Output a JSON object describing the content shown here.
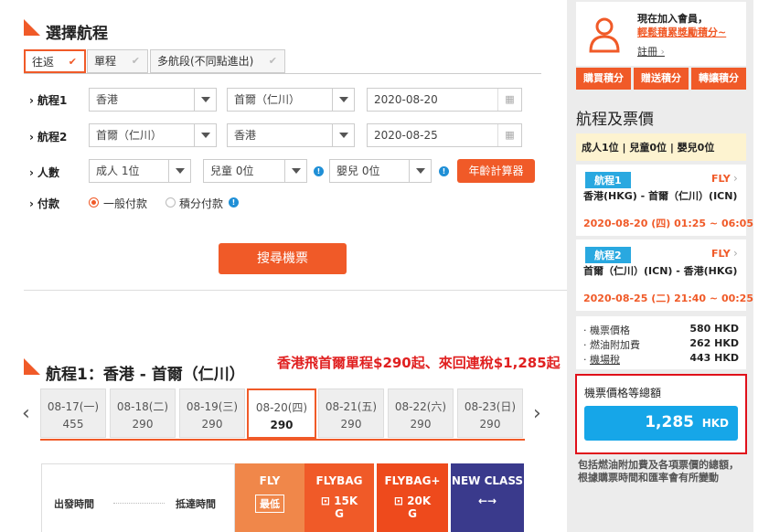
{
  "search": {
    "title": "選擇航程",
    "tabs": [
      {
        "label": "往返",
        "active": true
      },
      {
        "label": "單程",
        "active": false
      },
      {
        "label": "多航段(不同點進出)",
        "active": false
      }
    ],
    "leg1": {
      "label": "航程1",
      "from": "香港",
      "to": "首爾（仁川）",
      "date": "2020-08-20"
    },
    "leg2": {
      "label": "航程2",
      "from": "首爾（仁川）",
      "to": "香港",
      "date": "2020-08-25"
    },
    "pax": {
      "label": "人數",
      "adult": "成人 1位",
      "child": "兒童 0位",
      "infant": "嬰兒 0位",
      "age_calc": "年齡計算器"
    },
    "payment": {
      "label": "付款",
      "opt1": "一般付款",
      "opt2": "積分付款"
    },
    "search_button": "搜尋機票"
  },
  "results": {
    "title": "航程1：香港 - 首爾（仁川）",
    "promo": "香港飛首爾單程$290起、來回連稅$1,285起",
    "dates": [
      {
        "date": "08-17(一)",
        "price": "455",
        "active": false
      },
      {
        "date": "08-18(二)",
        "price": "290",
        "active": false
      },
      {
        "date": "08-19(三)",
        "price": "290",
        "active": false
      },
      {
        "date": "08-20(四)",
        "price": "290",
        "active": true
      },
      {
        "date": "08-21(五)",
        "price": "290",
        "active": false
      },
      {
        "date": "08-22(六)",
        "price": "290",
        "active": false
      },
      {
        "date": "08-23(日)",
        "price": "290",
        "active": false
      }
    ],
    "depart_label": "出發時間",
    "arrive_label": "抵達時間",
    "fares": [
      {
        "name": "FLY",
        "sub": "最低",
        "color": "#f0874a"
      },
      {
        "name": "FLYBAG",
        "sub": "15K",
        "sub2": "G",
        "color": "#f05a28"
      },
      {
        "name": "FLYBAG+",
        "sub": "20K",
        "sub2": "G",
        "color": "#ee4a1c"
      },
      {
        "name": "NEW CLASS",
        "sub": "←→",
        "color": "#3a3a8c"
      }
    ]
  },
  "member": {
    "line1": "現在加入會員，",
    "line2": "輕鬆積累獎勵積分~",
    "register": "註冊",
    "buttons": [
      "購買積分",
      "贈送積分",
      "轉讓積分"
    ]
  },
  "summary": {
    "title": "航程及票價",
    "pax": "成人1位 | 兒童0位 | 嬰兒0位",
    "legs": [
      {
        "badge": "航程1",
        "fare": "FLY",
        "route": "香港(HKG) - 首爾（仁川）(ICN)",
        "time": "2020-08-20 (四) 01:25 ~ 06:05"
      },
      {
        "badge": "航程2",
        "fare": "FLY",
        "route": "首爾（仁川）(ICN) - 香港(HKG)",
        "time": "2020-08-25 (二) 21:40 ~ 00:25"
      }
    ],
    "costs": [
      {
        "label": "機票價格",
        "value": "580 HKD"
      },
      {
        "label": "燃油附加費",
        "value": "262 HKD"
      },
      {
        "label": "機場稅",
        "value": "443 HKD"
      }
    ],
    "total_label": "機票價格等總額",
    "total_value": "1,285",
    "total_currency": "HKD",
    "note": "包括燃油附加費及各項票價的總額，根據購票時間和匯率會有所變動"
  }
}
